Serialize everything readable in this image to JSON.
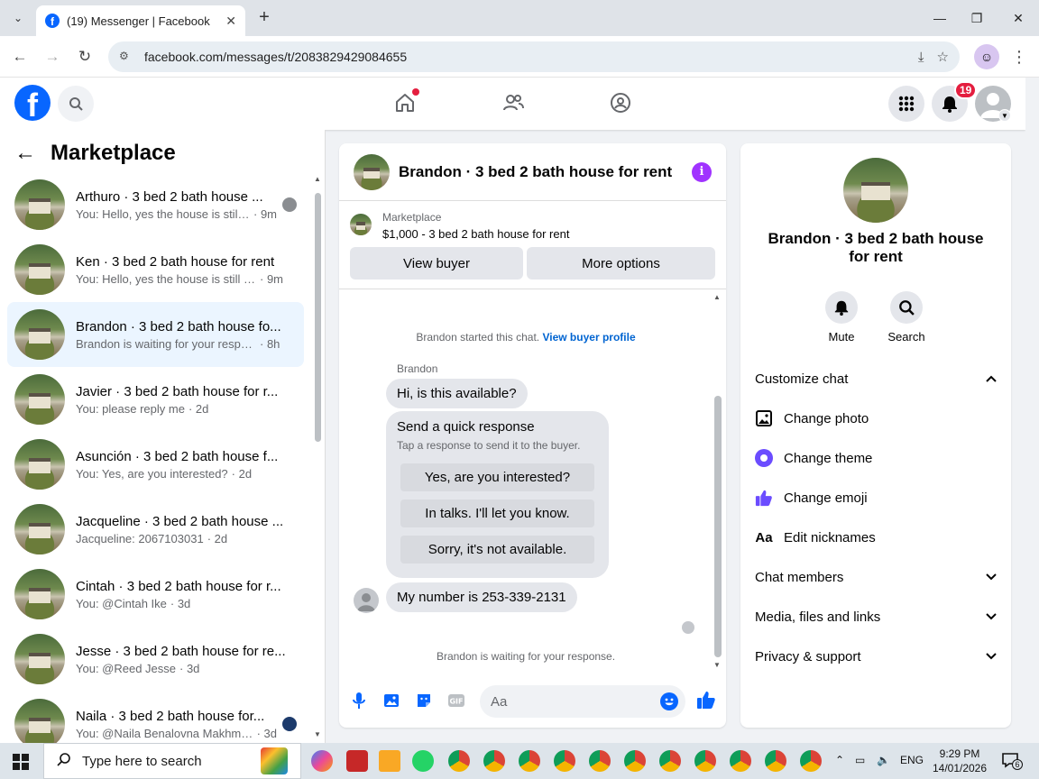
{
  "browser": {
    "tab_title": "(19) Messenger | Facebook",
    "url": "facebook.com/messages/t/2083829429084655",
    "new_tab": "+",
    "close": "✕",
    "minimize": "—",
    "maximize": "❐",
    "win_close": "✕"
  },
  "header": {
    "notification_count": "19"
  },
  "sidebar": {
    "title": "Marketplace",
    "conversations": [
      {
        "name": "Arthuro · 3 bed 2 bath house ...",
        "preview": "You: Hello, yes the house is still ...",
        "time": "· 9m"
      },
      {
        "name": "Ken · 3 bed 2 bath house for rent",
        "preview": "You: Hello, yes the house is still av...",
        "time": "· 9m"
      },
      {
        "name": "Brandon · 3 bed 2 bath house fo...",
        "preview": "Brandon is waiting for your respon...",
        "time": "· 8h"
      },
      {
        "name": "Javier · 3 bed 2 bath house for r...",
        "preview": "You: please reply me",
        "time": "· 2d"
      },
      {
        "name": "Asunción · 3 bed 2 bath house f...",
        "preview": "You: Yes, are you interested?",
        "time": "· 2d"
      },
      {
        "name": "Jacqueline · 3 bed 2 bath house ...",
        "preview": "Jacqueline: 2067103031",
        "time": "· 2d"
      },
      {
        "name": "Cintah · 3 bed 2 bath house for r...",
        "preview": "You: @Cintah Ike",
        "time": "· 3d"
      },
      {
        "name": "Jesse · 3 bed 2 bath house for re...",
        "preview": "You: @Reed Jesse",
        "time": "· 3d"
      },
      {
        "name": "Naila · 3 bed 2 bath house for...",
        "preview": "You: @Naila Benalovna Makhmu...",
        "time": "· 3d"
      }
    ]
  },
  "chat": {
    "title": "Brandon · 3 bed 2 bath house for rent",
    "listing_label": "Marketplace",
    "listing_price": "$1,000 - 3 bed 2 bath house for rent",
    "view_buyer": "View buyer",
    "more_options": "More options",
    "started_text": "Brandon started this chat.",
    "view_profile_link": "View buyer profile",
    "sender_name": "Brandon",
    "msg1": "Hi, is this available?",
    "quick_title": "Send a quick response",
    "quick_sub": "Tap a response to send it to the buyer.",
    "quick_replies": [
      "Yes, are you interested?",
      "In talks. I'll let you know.",
      "Sorry, it's not available."
    ],
    "msg2": "My number is 253-339-2131",
    "waiting": "Brandon is waiting for your response.",
    "composer_placeholder": "Aa"
  },
  "info_panel": {
    "name": "Brandon · 3 bed 2 bath house for rent",
    "mute": "Mute",
    "search": "Search",
    "customize_chat": "Customize chat",
    "change_photo": "Change photo",
    "change_theme": "Change theme",
    "change_emoji": "Change emoji",
    "edit_nicknames": "Edit nicknames",
    "nickname_icon_text": "Aa",
    "chat_members": "Chat members",
    "media_files": "Media, files and links",
    "privacy": "Privacy & support"
  },
  "taskbar": {
    "search_placeholder": "Type here to search",
    "language": "ENG",
    "time": "9:29 PM",
    "date": "14/01/2026",
    "notif_count": "6"
  },
  "colors": {
    "fb_blue": "#0866ff",
    "badge_red": "#e41e3f",
    "theme_purple": "#a033ff",
    "link_blue": "#0064d1"
  }
}
